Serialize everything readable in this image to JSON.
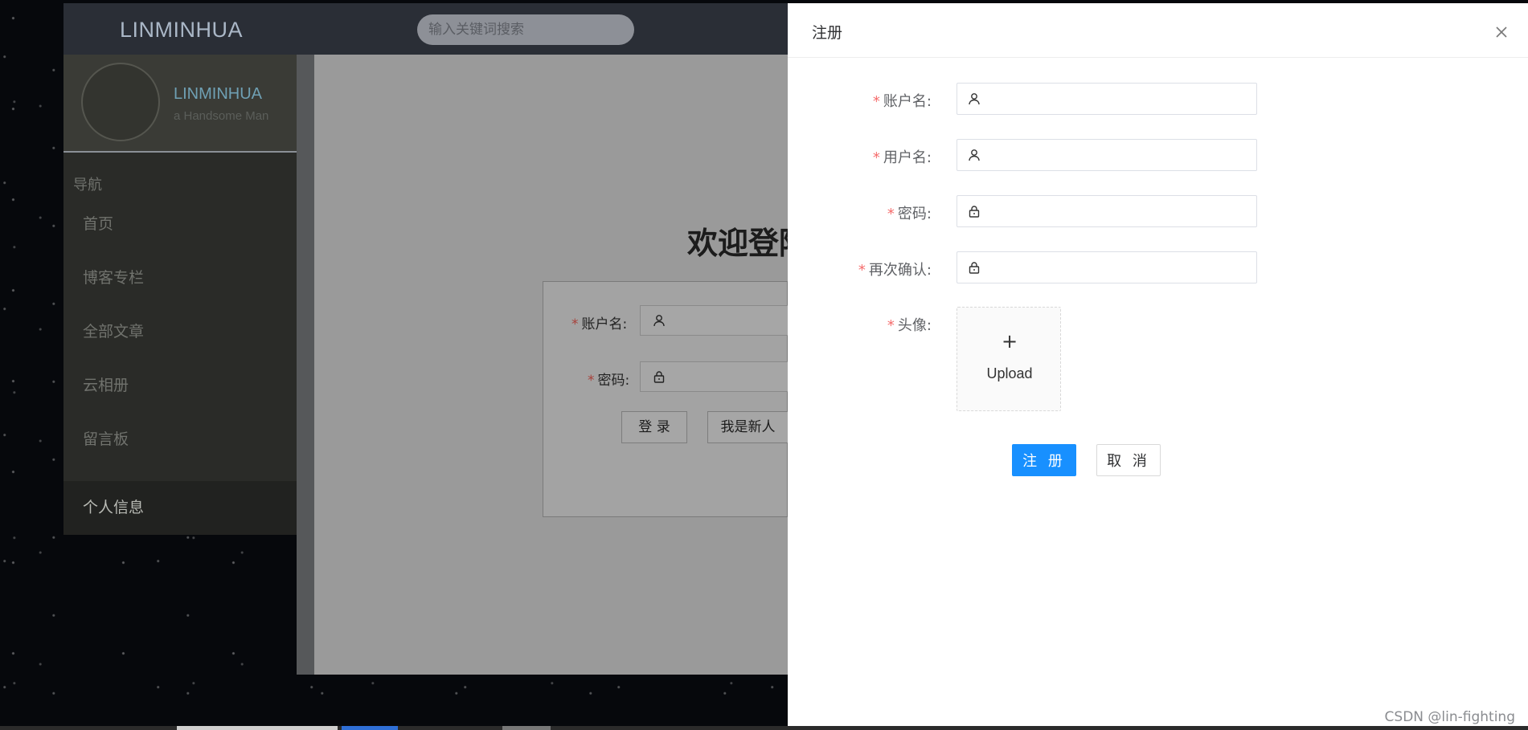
{
  "background_page": {
    "brand": "LINMINHUA",
    "search_placeholder": "输入关键词搜索",
    "profile": {
      "name": "LINMINHUA",
      "subtitle": "a Handsome Man"
    },
    "nav_title": "导航",
    "nav_items": [
      {
        "label": "首页"
      },
      {
        "label": "博客专栏"
      },
      {
        "label": "全部文章"
      },
      {
        "label": "云相册"
      },
      {
        "label": "留言板"
      },
      {
        "label": "个人信息",
        "active": true
      }
    ],
    "welcome": "欢迎登陆",
    "login_form": {
      "account_label": "账户名:",
      "password_label": "密码:",
      "login_button": "登 录",
      "new_user_button": "我是新人"
    }
  },
  "drawer": {
    "title": "注册",
    "close_icon": "close-icon",
    "fields": [
      {
        "label": "账户名:",
        "icon": "user-icon",
        "value": ""
      },
      {
        "label": "用户名:",
        "icon": "user-icon",
        "value": ""
      },
      {
        "label": "密码:",
        "icon": "lock-icon",
        "value": ""
      },
      {
        "label": "再次确认:",
        "icon": "lock-icon",
        "value": ""
      }
    ],
    "avatar_label": "头像:",
    "upload_plus": "+",
    "upload_text": "Upload",
    "submit_button": "注 册",
    "cancel_button": "取 消"
  },
  "watermark": "CSDN @lin-fighting",
  "colors": {
    "primary": "#1890ff",
    "required_star": "#f56c6c",
    "sidebar_bg": "#2a2b28",
    "topbar_bg": "#2a2e36"
  }
}
